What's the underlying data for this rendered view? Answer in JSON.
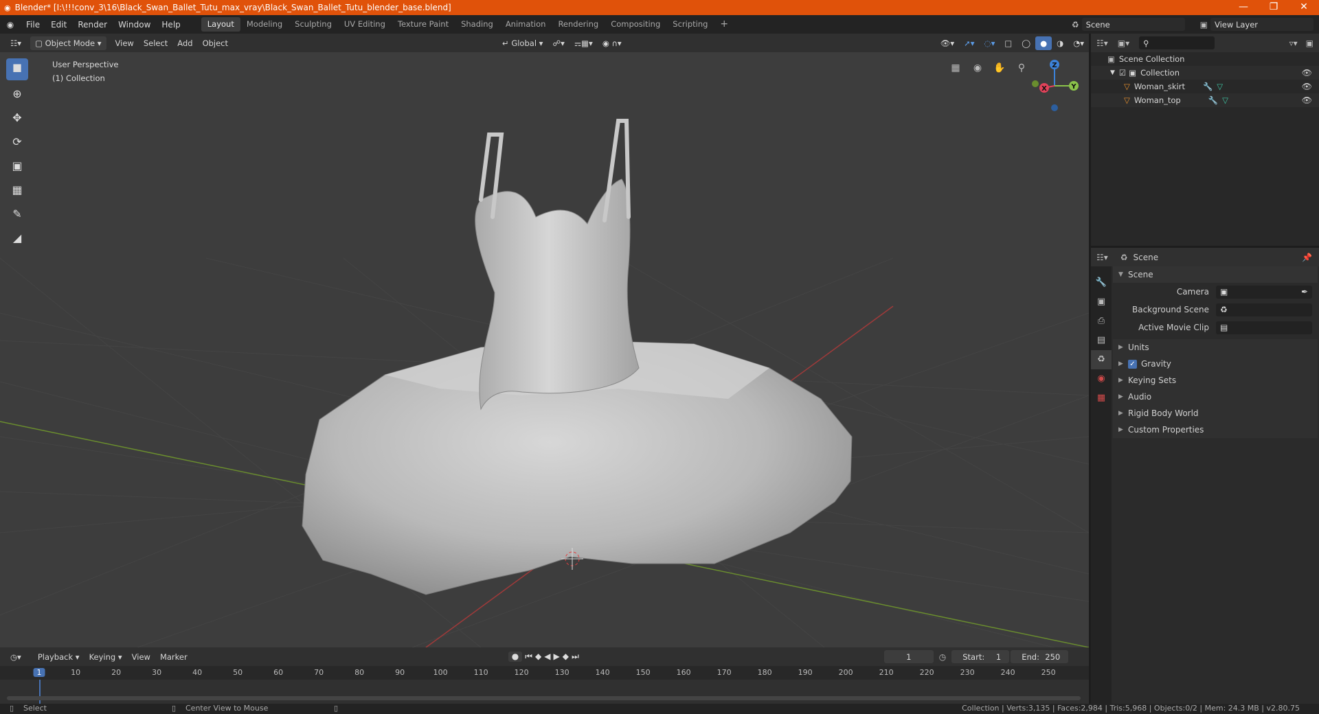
{
  "window": {
    "title": "Blender* [I:\\!!!conv_3\\16\\Black_Swan_Ballet_Tutu_max_vray\\Black_Swan_Ballet_Tutu_blender_base.blend]",
    "minimize": "—",
    "maximize": "❐",
    "close": "✕"
  },
  "menu": [
    "File",
    "Edit",
    "Render",
    "Window",
    "Help"
  ],
  "workspaces": [
    "Layout",
    "Modeling",
    "Sculpting",
    "UV Editing",
    "Texture Paint",
    "Shading",
    "Animation",
    "Rendering",
    "Compositing",
    "Scripting"
  ],
  "active_workspace": "Layout",
  "scene_field": "Scene",
  "view_layer_field": "View Layer",
  "viewport_header": {
    "mode": "Object Mode",
    "menus": [
      "View",
      "Select",
      "Add",
      "Object"
    ],
    "orientation": "Global"
  },
  "viewport_overlay": {
    "line1": "User Perspective",
    "line2": "(1) Collection"
  },
  "gizmo": {
    "x": "X",
    "y": "Y",
    "z": "Z"
  },
  "outliner": {
    "root": "Scene Collection",
    "collection": "Collection",
    "items": [
      "Woman_skirt",
      "Woman_top"
    ]
  },
  "properties": {
    "header": "Scene",
    "panel": "Scene",
    "fields": [
      {
        "label": "Camera",
        "value": ""
      },
      {
        "label": "Background Scene",
        "value": ""
      },
      {
        "label": "Active Movie Clip",
        "value": ""
      }
    ],
    "sections": [
      "Units",
      "Gravity",
      "Keying Sets",
      "Audio",
      "Rigid Body World",
      "Custom Properties"
    ],
    "gravity_checked": true
  },
  "timeline": {
    "menus": [
      "Playback",
      "Keying",
      "View",
      "Marker"
    ],
    "current_frame": "1",
    "start_label": "Start:",
    "start": "1",
    "end_label": "End:",
    "end": "250",
    "ruler": [
      "1",
      "10",
      "20",
      "30",
      "40",
      "50",
      "60",
      "70",
      "80",
      "90",
      "100",
      "110",
      "120",
      "130",
      "140",
      "150",
      "160",
      "170",
      "180",
      "190",
      "200",
      "210",
      "220",
      "230",
      "240",
      "250"
    ]
  },
  "status": {
    "left": "Select",
    "middle": "Center View to Mouse",
    "right": "Collection | Verts:3,135 | Faces:2,984 | Tris:5,968 | Objects:0/2 | Mem: 24.3 MB | v2.80.75"
  },
  "colors": {
    "titlebar": "#e0520a",
    "accent": "#4772b3",
    "x_axis": "#e2425a",
    "y_axis": "#8bc34a",
    "z_axis": "#3c82d8"
  }
}
